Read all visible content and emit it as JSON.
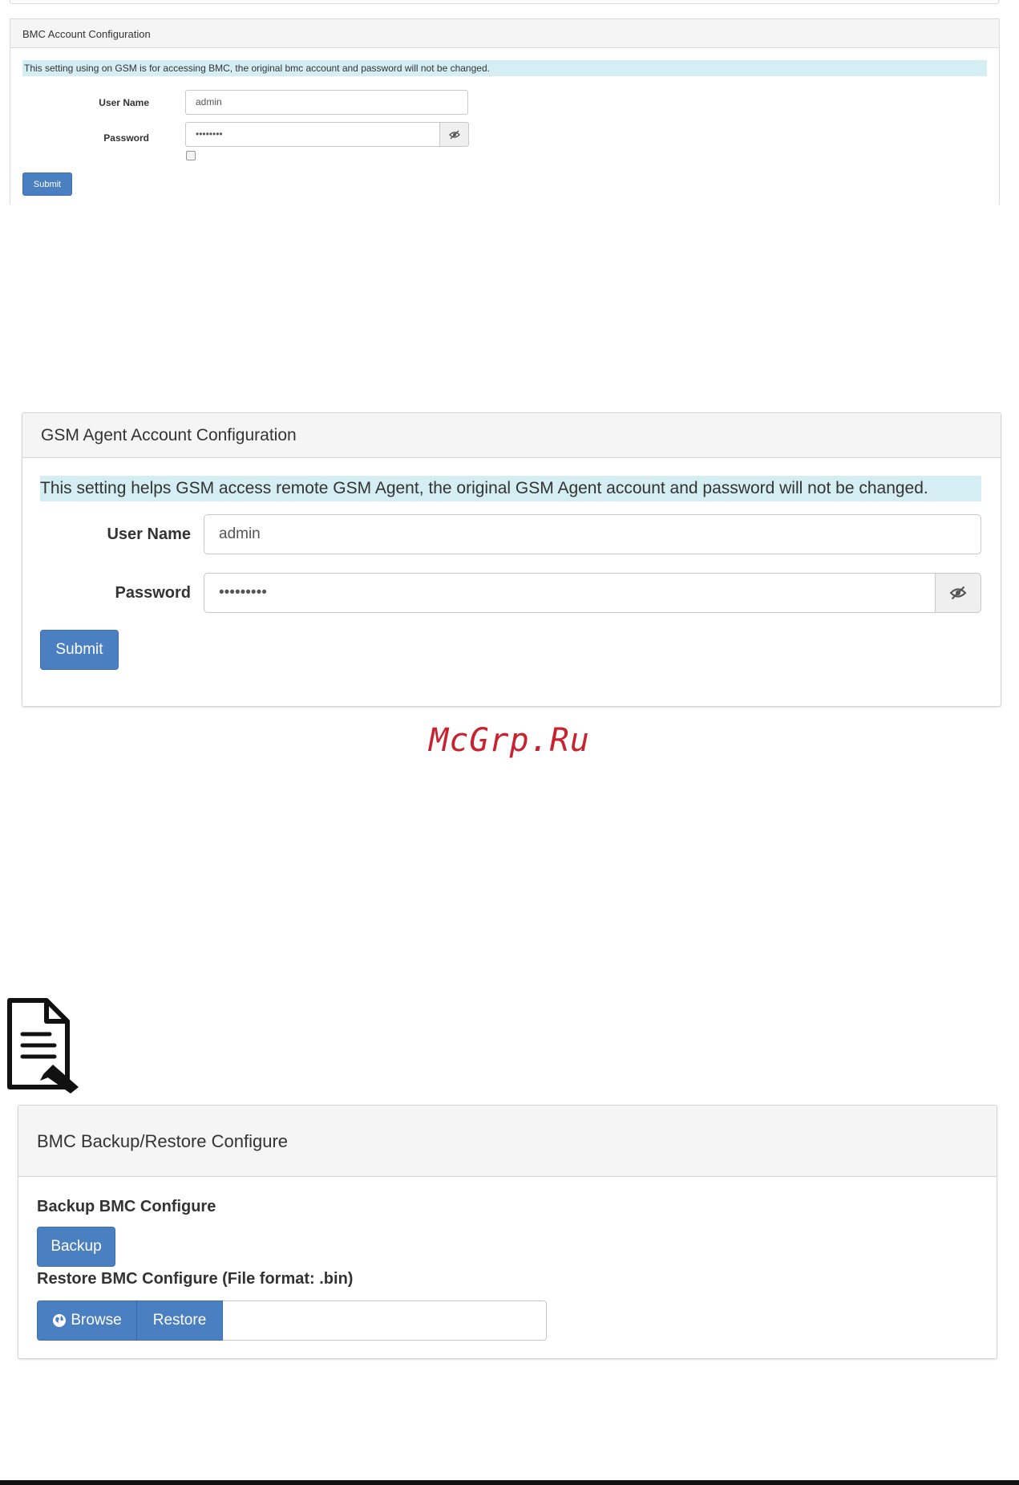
{
  "bmc_account": {
    "title": "BMC Account Configuration",
    "note": "This setting using on GSM is for accessing BMC, the original bmc account and password will not be changed.",
    "username_label": "User Name",
    "username_value": "admin",
    "password_label": "Password",
    "password_value": "••••••••",
    "submit_label": "Submit"
  },
  "gsm_agent_account": {
    "title": "GSM Agent Account Configuration",
    "note": "This setting helps GSM access remote GSM Agent, the original GSM Agent account and password will not be changed.",
    "username_label": "User Name",
    "username_value": "admin",
    "password_label": "Password",
    "password_value": "•••••••••",
    "submit_label": "Submit"
  },
  "watermark": "McGrp.Ru",
  "backup_restore": {
    "title": "BMC Backup/Restore Configure",
    "backup_heading": "Backup BMC Configure",
    "backup_button": "Backup",
    "restore_heading": "Restore BMC Configure (File format: .bin)",
    "browse_button": "Browse",
    "restore_button": "Restore"
  },
  "colors": {
    "primary_button": "#4a7fc1",
    "info_highlight": "#d5eef4",
    "panel_header": "#f5f5f5",
    "watermark": "#c8212f"
  },
  "icons": [
    "eye-slash-icon",
    "globe-icon",
    "note-pencil-icon"
  ]
}
